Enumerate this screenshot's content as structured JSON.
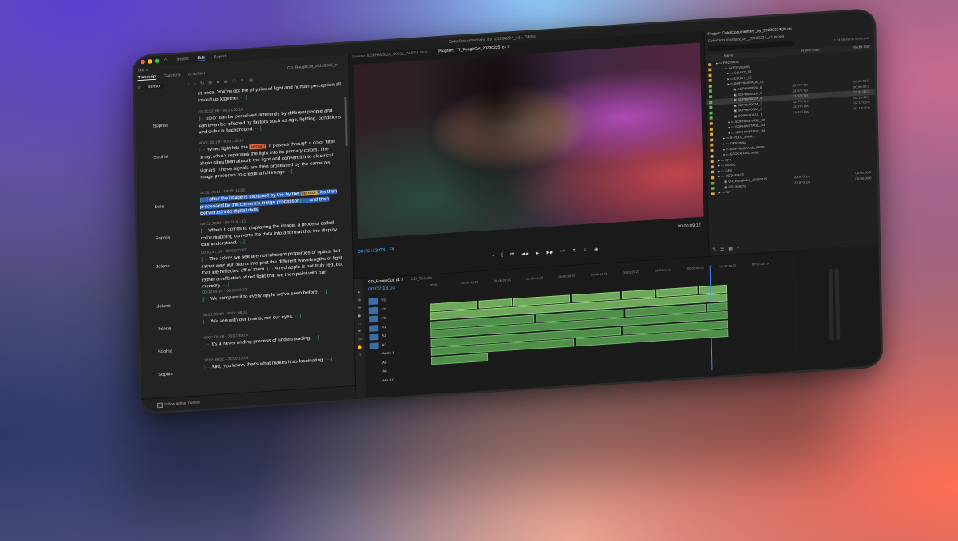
{
  "app": {
    "document_title": "ColorDocumentary_by_20230224_c1 - Edited",
    "nav": [
      "Import",
      "Edit",
      "Export"
    ],
    "active_nav": "Edit"
  },
  "left_panel": {
    "tab": "Text ≡",
    "subtabs": [
      "Transcript",
      "Captions",
      "Graphics"
    ],
    "sequence_name": "CD_RoughCut_20230225_c4",
    "search_value": "sensor",
    "follow_label": "Follow active monitor",
    "segments": [
      {
        "speaker": "",
        "timecode": "",
        "pre": "at once. You've got the physics of light and human perception all mixed up together.",
        "hl": "",
        "post": ""
      },
      {
        "speaker": "Sophia",
        "timecode": "00:00:57:06 - 00:01:00:16",
        "pre": "color can be perceived differently by different people and can even be affected by factors such as age, lighting, conditions and cultural background.",
        "hl": "",
        "post": ""
      },
      {
        "speaker": "Sophia",
        "timecode": "00:01:05:19 - 00:01:20:19",
        "pre": "When light hits the ",
        "hl": "sensor",
        "post": ", it passes through a color filter array, which separates the light into its primary colors. The photo sites then absorb the light and convert it into electrical signals. These signals are then processed by the camera's image processor to create a full image"
      },
      {
        "speaker": "Dale",
        "timecode": "00:01:23:15 - 00:01:32:06",
        "pre": "after the image is captured by the by the ",
        "hl": "sensor",
        "post": ", it's then processed by the camera's image processor"
      },
      {
        "speaker": "Sophia",
        "timecode": "00:01:32:00 - 00:01:41:13",
        "pre": "When it comes to displaying the image, a process called color mapping converts the data into a format that the display can understand.",
        "hl": "",
        "post": ""
      },
      {
        "speaker": "Jolene",
        "timecode": "00:01:41:14 - 00:02:00:07",
        "pre": "The colors we see are not inherent properties of optics, but rather way our brains interpret the different wavelengths of light that are reflected off of them.",
        "hl": "",
        "post": "A red apple is not truly red, but rather a reflection of red light that we then paint with our memory."
      },
      {
        "speaker": "Jolene",
        "timecode": "00:02:00:07 - 00:02:03:03",
        "pre": "We compare it to every apple we've seen before.",
        "hl": "",
        "post": ""
      },
      {
        "speaker": "Jolene",
        "timecode": "00:02:03:00 - 00:02:08:15",
        "pre": "We see with our brains, not our eyes.",
        "hl": "",
        "post": ""
      },
      {
        "speaker": "Sophia",
        "timecode": "00:02:08:16 - 00:02:09:18",
        "pre": "It's a never ending process of understanding.",
        "hl": "",
        "post": ""
      },
      {
        "speaker": "Sophia",
        "timecode": "00:02:09:20 - 00:02:13:01",
        "pre": "And, you know, that's what makes it so fascinating.",
        "hl": "",
        "post": ""
      }
    ],
    "dale_extra": "and then converted into digital data."
  },
  "monitor": {
    "tabs": [
      "Source: SOPHIA002A_0001L_ALEXA.mov",
      "Program: TT_RoughCut_20230225_c1 ≡"
    ],
    "timecode": "00:02:13:03",
    "fit": "Fit",
    "right_timecode": "00:00:09:12",
    "quality": "Full"
  },
  "project": {
    "title": "Project: ColorDocumentary_by_20230224_c1 ≡",
    "other_tab": "Effects",
    "name": "ColorDocumentary_by_20230224_c1.prproj",
    "items_count": "1 of 56 items selected",
    "headers": [
      "Name",
      "Frame Rate",
      "Media Star"
    ],
    "rows": [
      {
        "indent": 0,
        "name": "FOOTAGE",
        "rate": "",
        "start": "",
        "color": "#e2a23b"
      },
      {
        "indent": 1,
        "name": "INTERVIEWS",
        "rate": "",
        "start": "",
        "color": "#e2a23b"
      },
      {
        "indent": 2,
        "name": "CLUSTI_01",
        "rate": "",
        "start": "",
        "color": "#e2a23b"
      },
      {
        "indent": 2,
        "name": "CLUSTI_02",
        "rate": "",
        "start": "",
        "color": "#e2a23b"
      },
      {
        "indent": 2,
        "name": "SOPHIASTAGE_01",
        "rate": "",
        "start": "",
        "color": "#e2a23b"
      },
      {
        "indent": 3,
        "name": "SOPHIA002A_6",
        "rate": "23.976 fps",
        "start": "00:00:00:0",
        "color": "#5fb357"
      },
      {
        "indent": 3,
        "name": "SOPHIA002A_5",
        "rate": "23.976 fps",
        "start": "00:00:00:1",
        "color": "#5fb357"
      },
      {
        "indent": 3,
        "name": "SOPHIA002A_4",
        "rate": "23.976 fps",
        "start": "03:41:38:1",
        "color": "#5fb357",
        "sel": true
      },
      {
        "indent": 3,
        "name": "SOPHIA002A_3",
        "rate": "23.976 fps",
        "start": "02:16:39:1",
        "color": "#5fb357"
      },
      {
        "indent": 3,
        "name": "SOPHIA002A_2",
        "rate": "23.976 fps",
        "start": "02:17:08:0",
        "color": "#5fb357"
      },
      {
        "indent": 3,
        "name": "SOPHIA002A_1",
        "rate": "23.976 fps",
        "start": "02:13:22:0",
        "color": "#5fb357"
      },
      {
        "indent": 2,
        "name": "SOPHIASTAGE_02",
        "rate": "",
        "start": "",
        "color": "#e2a23b"
      },
      {
        "indent": 2,
        "name": "SOPHIASTAGE_03",
        "rate": "",
        "start": "",
        "color": "#e2a23b"
      },
      {
        "indent": 2,
        "name": "SOPHIASTAGE_04",
        "rate": "",
        "start": "",
        "color": "#e2a23b"
      },
      {
        "indent": 1,
        "name": "B-ROLL_SMALL",
        "rate": "",
        "start": "",
        "color": "#e2a23b"
      },
      {
        "indent": 1,
        "name": "ORIGINAL",
        "rate": "",
        "start": "",
        "color": "#e2a23b"
      },
      {
        "indent": 1,
        "name": "SOPHIASTAGE_BROLL",
        "rate": "",
        "start": "",
        "color": "#e2a23b"
      },
      {
        "indent": 1,
        "name": "STOCK FOOTAGE",
        "rate": "",
        "start": "",
        "color": "#e2a23b"
      },
      {
        "indent": 0,
        "name": "SFX",
        "rate": "",
        "start": "",
        "color": "#e2a23b"
      },
      {
        "indent": 0,
        "name": "MUSIC",
        "rate": "",
        "start": "",
        "color": "#e2a23b"
      },
      {
        "indent": 0,
        "name": "GFX",
        "rate": "",
        "start": "",
        "color": "#e2a23b"
      },
      {
        "indent": 0,
        "name": "SEQUENCE",
        "rate": "",
        "start": "",
        "color": "#e2a23b"
      },
      {
        "indent": 1,
        "name": "CD_RoughCut_20230225",
        "rate": "23.976 fps",
        "start": "00:00:00:0",
        "color": "#5fb357"
      },
      {
        "indent": 1,
        "name": "CD_Selects",
        "rate": "23.976 fps",
        "start": "00:00:00:0",
        "color": "#5fb357"
      },
      {
        "indent": 0,
        "name": "DIT",
        "rate": "",
        "start": "",
        "color": "#e2a23b"
      }
    ]
  },
  "timeline": {
    "tabs": [
      "CD_RoughCut_c1 ≡",
      "CD_Selects"
    ],
    "timecode": "00:02:13:03",
    "ruler": [
      "00:00",
      "00:00:14:23",
      "00:00:29:23",
      "00:00:44:22",
      "00:00:59:22",
      "00:01:14:21",
      "00:01:29:21",
      "00:01:44:21",
      "00:01:59:20",
      "00:02:14:20",
      "00:02:29:19"
    ],
    "tracks": [
      "V3",
      "V2",
      "V1",
      "A1",
      "A2",
      "A3",
      "Audio 1",
      "A5",
      "A6",
      "Mix"
    ],
    "mix_value": "0.0"
  },
  "colors": {
    "accent": "#4aa3ff",
    "clip_video": "#6ea85b",
    "clip_audio": "#4f8f4a",
    "highlight_word": "#e06c45",
    "highlight_block": "#2d5fb4"
  }
}
